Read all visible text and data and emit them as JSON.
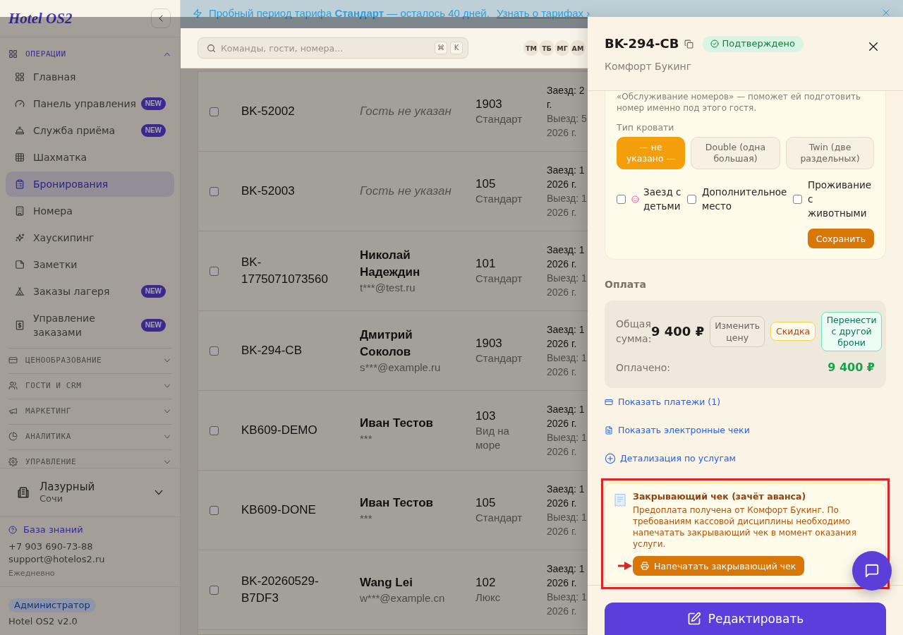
{
  "banner": {
    "text": "Пробный период тарифа **Стандарт** — осталось 40 дней.",
    "link": "Узнать о тарифах ›"
  },
  "sidebar": {
    "logo": "Hotel OS2",
    "sections": [
      {
        "label": "ОПЕРАЦИИ",
        "expanded": true,
        "items": [
          {
            "label": "Главная",
            "selected": false
          },
          {
            "label": "Панель управления",
            "selected": false,
            "badge": "NEW"
          },
          {
            "label": "Служба приёма",
            "selected": false,
            "badge": "NEW"
          },
          {
            "label": "Шахматка",
            "selected": false
          },
          {
            "label": "Бронирования",
            "selected": true
          },
          {
            "label": "Номера",
            "selected": false
          },
          {
            "label": "Хаускипинг",
            "selected": false
          },
          {
            "label": "Заметки",
            "selected": false
          },
          {
            "label": "Заказы лагеря",
            "selected": false,
            "badge": "NEW"
          },
          {
            "label": "Управление заказами",
            "selected": false,
            "badge": "NEW"
          }
        ]
      },
      {
        "label": "ЦЕНООБРАЗОВАНИЕ",
        "expanded": false
      },
      {
        "label": "ГОСТИ И CRM",
        "expanded": false
      },
      {
        "label": "МАРКЕТИНГ",
        "expanded": false
      },
      {
        "label": "АНАЛИТИКА",
        "expanded": false
      },
      {
        "label": "УПРАВЛЕНИЕ",
        "expanded": false
      }
    ],
    "property": {
      "name": "Лазурный",
      "city": "Сочи"
    },
    "help": {
      "link": "База знаний",
      "phone": "+7 903 690-73-88",
      "email": "support@hotelos2.ru",
      "hours": "Ежедневно"
    },
    "role": "Администратор",
    "version": "Hotel OS2 v2.0"
  },
  "header": {
    "search": {
      "placeholder": "Команды, гости, номера...",
      "shortcut": [
        "⌘",
        "K"
      ]
    },
    "avatars": [
      "ТМ",
      "ТБ",
      "МГ",
      "АМ"
    ]
  },
  "table": {
    "rows": [
      {
        "checked": false,
        "id": "BK-52002",
        "guest": {
          "kind": "missing",
          "name": "Гость не указан"
        },
        "room": {
          "number": "1903",
          "type": "Стандарт"
        },
        "check_in": [
          "Заезд: 2",
          "г."
        ],
        "check_out": [
          "Выезд: 5",
          "2026 г."
        ]
      },
      {
        "checked": false,
        "id": "BK-52003",
        "guest": {
          "kind": "missing",
          "name": "Гость не указан"
        },
        "room": {
          "number": "105",
          "type": "Стандарт"
        },
        "check_in": [
          "Заезд: 1",
          "2026 г."
        ],
        "check_out": [
          "Выезд: 1",
          "2026 г."
        ]
      },
      {
        "checked": false,
        "id": "BK-1775071073560",
        "guest": {
          "kind": "named",
          "name": "Николай Надеждин",
          "email": "t***@test.ru"
        },
        "room": {
          "number": "101",
          "type": "Стандарт"
        },
        "check_in": [
          "Заезд: 1",
          "2026 г."
        ],
        "check_out": [
          "Выезд: 1",
          "2026 г."
        ]
      },
      {
        "checked": false,
        "id": "BK-294-CB",
        "guest": {
          "kind": "named",
          "name": "Дмитрий Соколов",
          "email": "s***@example.ru"
        },
        "room": {
          "number": "1903",
          "type": "Стандарт"
        },
        "check_in": [
          "Заезд: 1",
          "2026 г."
        ],
        "check_out": [
          "Выезд: 1",
          "2026 г."
        ]
      },
      {
        "checked": false,
        "id": "KB609-DEMO",
        "guest": {
          "kind": "named",
          "name": "Иван Тестов",
          "email": "***"
        },
        "room": {
          "number": "103",
          "type": "Вид на море"
        },
        "check_in": [
          "Заезд: 1",
          "2026 г."
        ],
        "check_out": [
          "Выезд: 1",
          "2026 г."
        ]
      },
      {
        "checked": false,
        "id": "KB609-DONE",
        "guest": {
          "kind": "named",
          "name": "Иван Тестов",
          "email": "***"
        },
        "room": {
          "number": "105",
          "type": "Стандарт"
        },
        "check_in": [
          "Заезд: 1",
          "2026 г."
        ],
        "check_out": [
          "Выезд: 1",
          "2026 г."
        ]
      },
      {
        "checked": false,
        "id": "BK-20260529-B7DF3",
        "guest": {
          "kind": "named",
          "name": "Wang Lei",
          "email": "w***@example.cn"
        },
        "room": {
          "number": "102",
          "type": "Люкс"
        },
        "check_in": [
          "Заезд: 1",
          "2026 г."
        ],
        "check_out": [
          "Выезд: 1",
          "2026 г."
        ]
      }
    ]
  },
  "drawer": {
    "title": "BK-294-CB",
    "status": "Подтверждено",
    "subtitle": "Комфорт Букинг",
    "preferences": {
      "note": "«Обслуживание номеров» — поможет ей подготовить номер именно под этого гостя.",
      "bed_label": "Тип кровати",
      "bed_options": [
        {
          "label": "— не указано —",
          "selected": true
        },
        {
          "label": "Double (одна большая)",
          "selected": false
        },
        {
          "label": "Twin (две раздельных)",
          "selected": false
        }
      ],
      "options": [
        {
          "label": "Заезд с детьми",
          "checked": false,
          "kind": "icon"
        },
        {
          "label": "Дополнительное место",
          "checked": false,
          "kind": "plain"
        },
        {
          "label": "Проживание с животными",
          "checked": false,
          "kind": "plain"
        }
      ],
      "save": "Сохранить"
    },
    "payment": {
      "heading": "Оплата",
      "total_label": "Общая сумма:",
      "total": "9 400 ₽",
      "actions": [
        {
          "label": "Изменить цену",
          "kind": "neutral"
        },
        {
          "label": "Скидка",
          "kind": "discount"
        },
        {
          "label": "Перенести с другой брони",
          "kind": "transfer"
        }
      ],
      "paid_label": "Оплачено:",
      "paid": "9 400 ₽"
    },
    "links": [
      "Показать платежи (1)",
      "Показать электронные чеки",
      "Детализация по услугам"
    ],
    "closing_receipt": {
      "title": "Закрывающий чек (зачёт аванса)",
      "text": "Предоплата получена от Комфорт Букинг. По требованиям кассовой дисциплины необходимо напечатать закрывающий чек в момент оказания услуги.",
      "button": "Напечатать закрывающий чек"
    },
    "edit": "Редактировать"
  }
}
